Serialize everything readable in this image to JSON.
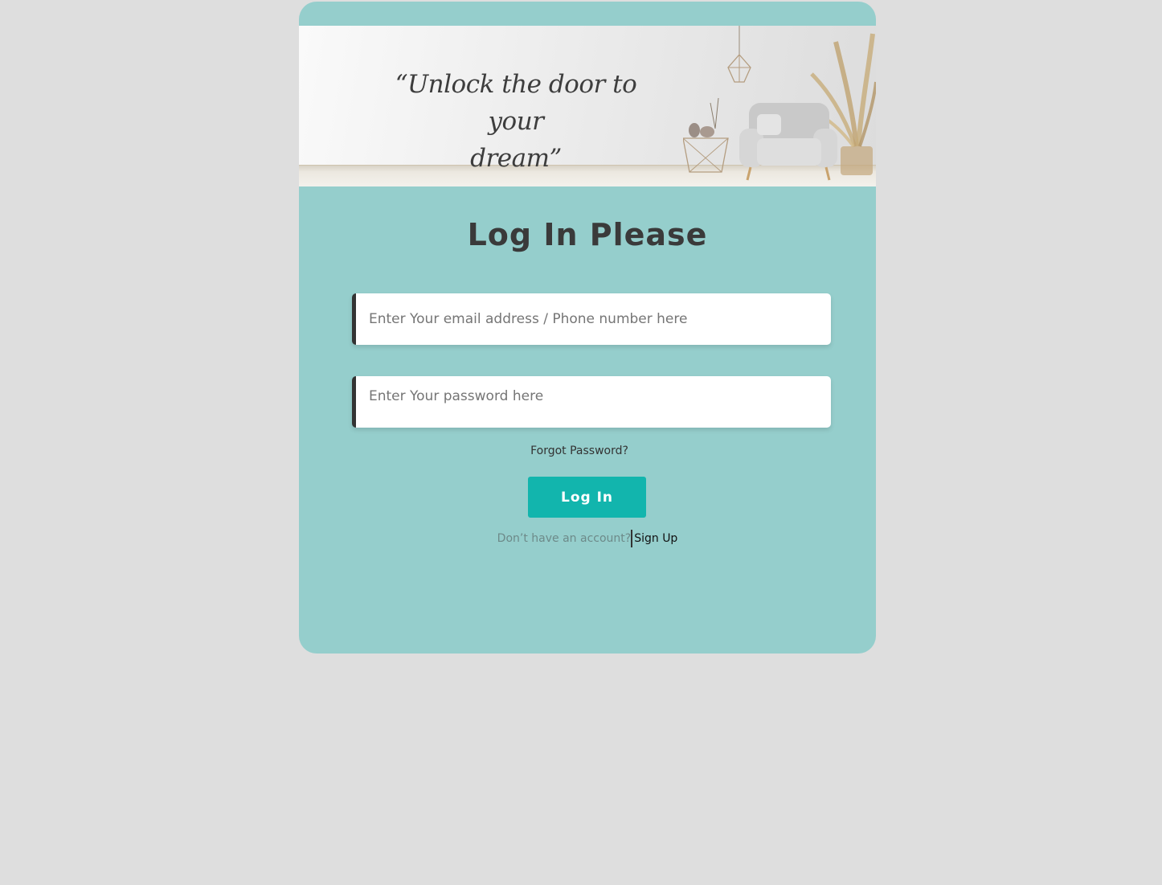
{
  "banner": {
    "quote_line1": "“Unlock the door to your",
    "quote_line2": "dream”"
  },
  "login": {
    "title": "Log In Please",
    "email_placeholder": "Enter Your email address / Phone number here",
    "password_placeholder": "Enter Your password here",
    "forgot_label": "Forgot Password?",
    "button_label": "Log In",
    "signup_prompt": "Don’t have an account?",
    "signup_link": "Sign Up"
  },
  "colors": {
    "page_bg": "#dedede",
    "card_bg": "#95cecc",
    "button_bg": "#12b5ad",
    "text_dark": "#3a3a3a"
  },
  "icons": [
    "pendant-lamp-icon",
    "armchair-icon",
    "side-table-icon",
    "pampas-plant-icon"
  ]
}
